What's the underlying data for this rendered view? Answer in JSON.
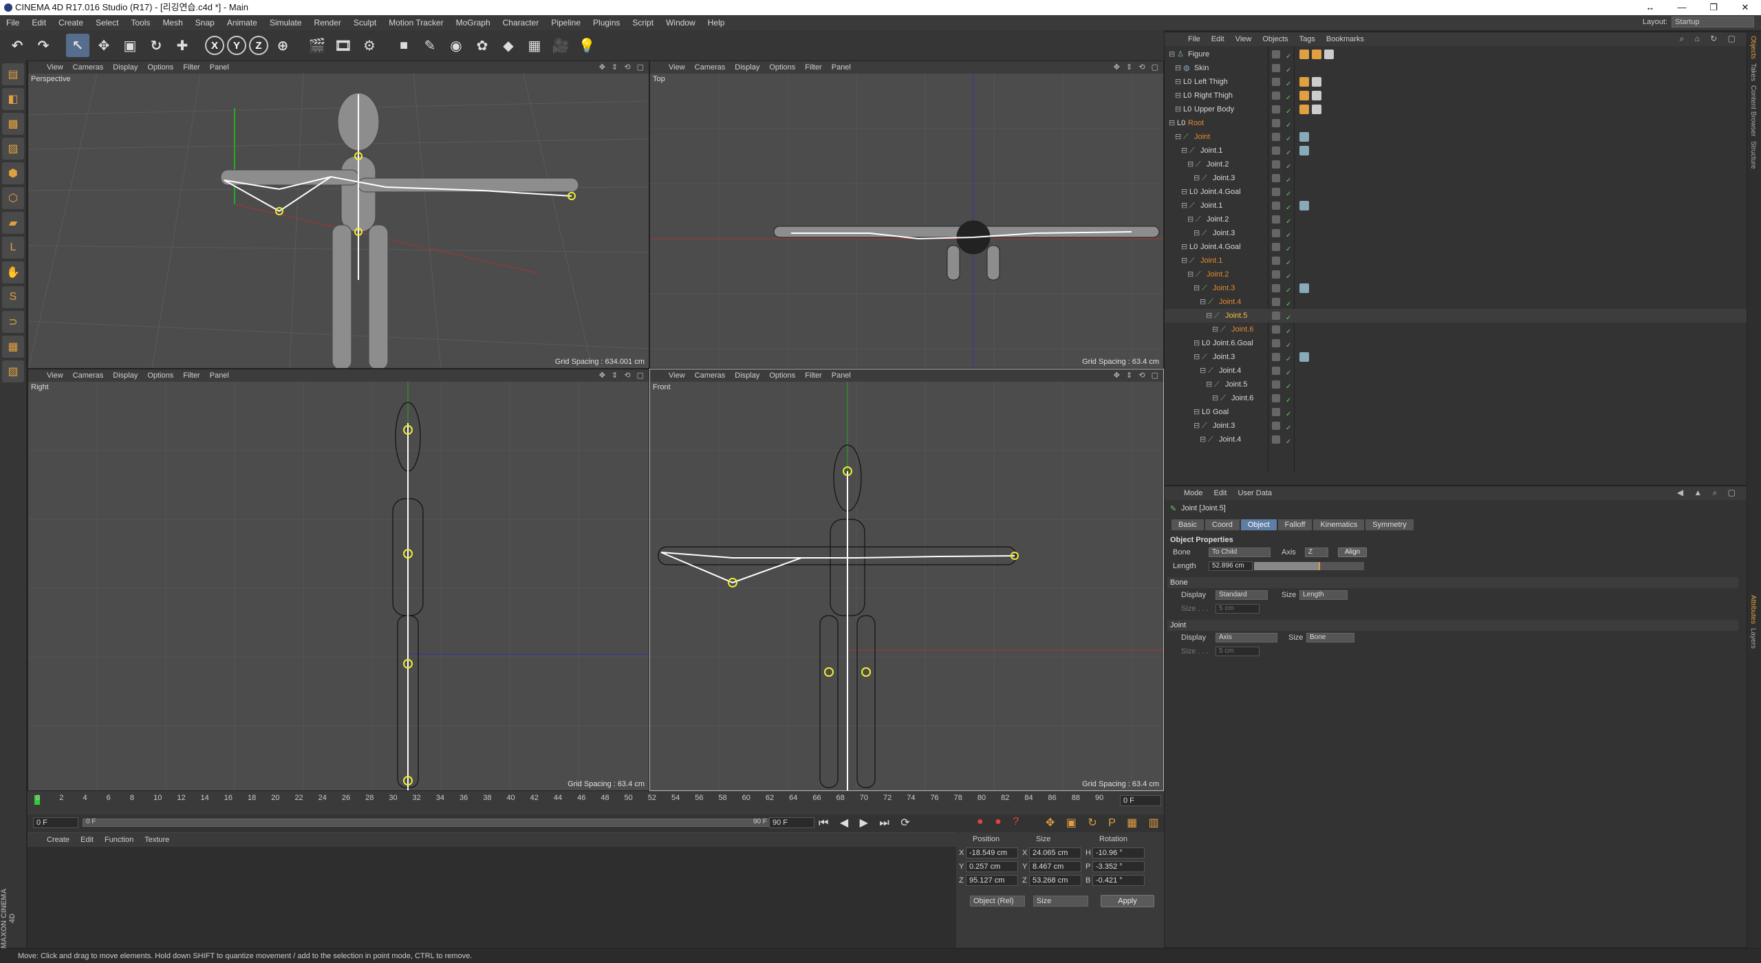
{
  "window": {
    "title": "CINEMA 4D R17.016 Studio (R17) - [리깅연습.c4d *] - Main",
    "controls": [
      "↔",
      "—",
      "❐",
      "✕"
    ]
  },
  "menubar": [
    "File",
    "Edit",
    "Create",
    "Select",
    "Tools",
    "Mesh",
    "Snap",
    "Animate",
    "Simulate",
    "Render",
    "Sculpt",
    "Motion Tracker",
    "MoGraph",
    "Character",
    "Pipeline",
    "Plugins",
    "Script",
    "Window",
    "Help"
  ],
  "layout": {
    "label": "Layout:",
    "value": "Startup"
  },
  "toolbar": {
    "icons": [
      {
        "name": "undo-icon",
        "glyph": "↶"
      },
      {
        "name": "redo-icon",
        "glyph": "↷"
      },
      {
        "name": "select-icon",
        "glyph": "↖"
      },
      {
        "name": "move-icon",
        "glyph": "✥"
      },
      {
        "name": "scale-icon",
        "glyph": "▣"
      },
      {
        "name": "rotate-icon",
        "glyph": "↻"
      },
      {
        "name": "add-icon",
        "glyph": "✚"
      },
      {
        "name": "x-axis-icon",
        "glyph": "X"
      },
      {
        "name": "y-axis-icon",
        "glyph": "Y"
      },
      {
        "name": "z-axis-icon",
        "glyph": "Z"
      },
      {
        "name": "coordinate-system-icon",
        "glyph": "⊕"
      },
      {
        "name": "render-view-icon",
        "glyph": "🎬"
      },
      {
        "name": "render-picture-viewer-icon",
        "glyph": "🎞"
      },
      {
        "name": "edit-render-settings-icon",
        "glyph": "⚙"
      },
      {
        "name": "cube-icon",
        "glyph": "■"
      },
      {
        "name": "pen-icon",
        "glyph": "✎"
      },
      {
        "name": "subdivision-icon",
        "glyph": "◉"
      },
      {
        "name": "array-icon",
        "glyph": "✿"
      },
      {
        "name": "deformer-icon",
        "glyph": "◆"
      },
      {
        "name": "floor-icon",
        "glyph": "▦"
      },
      {
        "name": "camera-icon",
        "glyph": "🎥"
      },
      {
        "name": "light-icon",
        "glyph": "💡"
      }
    ]
  },
  "lefttools": [
    {
      "name": "make-editable-icon",
      "glyph": "▤"
    },
    {
      "name": "model-mode-icon",
      "glyph": "◧"
    },
    {
      "name": "texture-mode-icon",
      "glyph": "▩"
    },
    {
      "name": "workplane-icon",
      "glyph": "▨"
    },
    {
      "name": "points-mode-icon",
      "glyph": "⬢"
    },
    {
      "name": "edges-mode-icon",
      "glyph": "⬡"
    },
    {
      "name": "polygons-mode-icon",
      "glyph": "▰"
    },
    {
      "name": "axis-mode-icon",
      "glyph": "L"
    },
    {
      "name": "tweak-mode-icon",
      "glyph": "✋"
    },
    {
      "name": "snap-icon",
      "glyph": "S"
    },
    {
      "name": "magnet-icon",
      "glyph": "⊃"
    },
    {
      "name": "locked-workplane-icon",
      "glyph": "▦"
    },
    {
      "name": "planar-workplane-icon",
      "glyph": "▧"
    }
  ],
  "maxon": "MAXON CINEMA 4D",
  "viewports": [
    {
      "id": "perspective",
      "label": "Perspective",
      "menu": [
        "View",
        "Cameras",
        "Display",
        "Options",
        "Filter",
        "Panel"
      ],
      "grid": "Grid Spacing : 634.001 cm"
    },
    {
      "id": "top",
      "label": "Top",
      "menu": [
        "View",
        "Cameras",
        "Display",
        "Options",
        "Filter",
        "Panel"
      ],
      "grid": "Grid Spacing : 63.4 cm"
    },
    {
      "id": "right",
      "label": "Right",
      "menu": [
        "View",
        "Cameras",
        "Display",
        "Options",
        "Filter",
        "Panel"
      ],
      "grid": "Grid Spacing : 63.4 cm"
    },
    {
      "id": "front",
      "label": "Front",
      "menu": [
        "View",
        "Cameras",
        "Display",
        "Options",
        "Filter",
        "Panel"
      ],
      "grid": "Grid Spacing : 63.4 cm"
    }
  ],
  "timeline": {
    "ticks": [
      "0",
      "2",
      "4",
      "6",
      "8",
      "10",
      "12",
      "14",
      "16",
      "18",
      "20",
      "22",
      "24",
      "26",
      "28",
      "30",
      "32",
      "34",
      "36",
      "38",
      "40",
      "42",
      "44",
      "46",
      "48",
      "50",
      "52",
      "54",
      "56",
      "58",
      "60",
      "62",
      "64",
      "66",
      "68",
      "70",
      "72",
      "74",
      "76",
      "78",
      "80",
      "82",
      "84",
      "86",
      "88",
      "90"
    ],
    "current_frame": "0 F",
    "start": "0 F",
    "end": "90 F",
    "range_min": "0 F",
    "range_max": "90 F"
  },
  "material_manager": {
    "menu": [
      "Create",
      "Edit",
      "Function",
      "Texture"
    ]
  },
  "coordinates": {
    "headers": [
      "Position",
      "Size",
      "Rotation"
    ],
    "rows": [
      {
        "axis": "X",
        "pos": "-18.549 cm",
        "size_axis": "X",
        "size": "24.065 cm",
        "rot_axis": "H",
        "rot": "-10.96 °"
      },
      {
        "axis": "Y",
        "pos": "0.257 cm",
        "size_axis": "Y",
        "size": "8.467 cm",
        "rot_axis": "P",
        "rot": "-3.352 °"
      },
      {
        "axis": "Z",
        "pos": "95.127 cm",
        "size_axis": "Z",
        "size": "53.268 cm",
        "rot_axis": "B",
        "rot": "-0.421 °"
      }
    ],
    "mode": "Object (Rel)",
    "size_mode": "Size",
    "apply": "Apply"
  },
  "object_manager": {
    "menu": [
      "File",
      "Edit",
      "View",
      "Objects",
      "Tags",
      "Bookmarks"
    ],
    "rows": [
      {
        "name": "Figure",
        "indent": 0,
        "color": "#d8d8d8",
        "icon": "figure",
        "tags": [
          "#e0a040",
          "#e0a040",
          "#ccc"
        ]
      },
      {
        "name": "Skin",
        "indent": 1,
        "color": "#d8d8d8",
        "icon": "skin",
        "tags": []
      },
      {
        "name": "Left Thigh",
        "indent": 1,
        "color": "#d8d8d8",
        "icon": "null",
        "tags": [
          "#e0a040",
          "#ccc"
        ]
      },
      {
        "name": "Right Thigh",
        "indent": 1,
        "color": "#d8d8d8",
        "icon": "null",
        "tags": [
          "#e0a040",
          "#ccc"
        ]
      },
      {
        "name": "Upper Body",
        "indent": 1,
        "color": "#d8d8d8",
        "icon": "null",
        "tags": [
          "#e0a040",
          "#ccc"
        ]
      },
      {
        "name": "Root",
        "indent": 0,
        "color": "#e08a30",
        "icon": "null",
        "tags": []
      },
      {
        "name": "Joint",
        "indent": 1,
        "color": "#e08a30",
        "icon": "joint",
        "tags": [
          "#8ab"
        ]
      },
      {
        "name": "Joint.1",
        "indent": 2,
        "color": "#d8d8d8",
        "icon": "joint",
        "tags": [
          "#8ab"
        ]
      },
      {
        "name": "Joint.2",
        "indent": 3,
        "color": "#d8d8d8",
        "icon": "joint",
        "tags": []
      },
      {
        "name": "Joint.3",
        "indent": 4,
        "color": "#d8d8d8",
        "icon": "joint",
        "tags": []
      },
      {
        "name": "Joint.4.Goal",
        "indent": 2,
        "color": "#d8d8d8",
        "icon": "null",
        "tags": []
      },
      {
        "name": "Joint.1",
        "indent": 2,
        "color": "#d8d8d8",
        "icon": "joint",
        "tags": [
          "#8ab"
        ]
      },
      {
        "name": "Joint.2",
        "indent": 3,
        "color": "#d8d8d8",
        "icon": "joint",
        "tags": []
      },
      {
        "name": "Joint.3",
        "indent": 4,
        "color": "#d8d8d8",
        "icon": "joint",
        "tags": []
      },
      {
        "name": "Joint.4.Goal",
        "indent": 2,
        "color": "#d8d8d8",
        "icon": "null",
        "tags": []
      },
      {
        "name": "Joint.1",
        "indent": 2,
        "color": "#e08a30",
        "icon": "joint",
        "tags": []
      },
      {
        "name": "Joint.2",
        "indent": 3,
        "color": "#e08a30",
        "icon": "joint",
        "tags": []
      },
      {
        "name": "Joint.3",
        "indent": 4,
        "color": "#e08a30",
        "icon": "joint",
        "tags": [
          "#8ab"
        ]
      },
      {
        "name": "Joint.4",
        "indent": 5,
        "color": "#e08a30",
        "icon": "joint",
        "tags": []
      },
      {
        "name": "Joint.5",
        "indent": 6,
        "color": "#f5c040",
        "icon": "joint",
        "tags": []
      },
      {
        "name": "Joint.6",
        "indent": 7,
        "color": "#e08a30",
        "icon": "joint",
        "tags": []
      },
      {
        "name": "Joint.6.Goal",
        "indent": 4,
        "color": "#d8d8d8",
        "icon": "null",
        "tags": []
      },
      {
        "name": "Joint.3",
        "indent": 4,
        "color": "#d8d8d8",
        "icon": "joint",
        "tags": [
          "#8ab"
        ]
      },
      {
        "name": "Joint.4",
        "indent": 5,
        "color": "#d8d8d8",
        "icon": "joint",
        "tags": []
      },
      {
        "name": "Joint.5",
        "indent": 6,
        "color": "#d8d8d8",
        "icon": "joint",
        "tags": []
      },
      {
        "name": "Joint.6",
        "indent": 7,
        "color": "#d8d8d8",
        "icon": "joint",
        "tags": []
      },
      {
        "name": "Goal",
        "indent": 4,
        "color": "#d8d8d8",
        "icon": "null",
        "tags": []
      },
      {
        "name": "Joint.3",
        "indent": 4,
        "color": "#d8d8d8",
        "icon": "joint",
        "tags": []
      },
      {
        "name": "Joint.4",
        "indent": 5,
        "color": "#d8d8d8",
        "icon": "joint",
        "tags": []
      }
    ]
  },
  "attribute_manager": {
    "menu": [
      "Mode",
      "Edit",
      "User Data"
    ],
    "title": "Joint [Joint.5]",
    "tabs": [
      "Basic",
      "Coord",
      "Object",
      "Falloff",
      "Kinematics",
      "Symmetry"
    ],
    "active_tab": "Object",
    "section": "Object Properties",
    "bone_label": "Bone",
    "bone_value": "To Child",
    "axis_label": "Axis",
    "axis_value": "Z",
    "align": "Align",
    "length_label": "Length",
    "length_value": "52.896 cm",
    "length_fraction": 0.6,
    "bone_group": "Bone",
    "bone_display_label": "Display",
    "bone_display_value": "Standard",
    "bone_size_label": "Size",
    "bone_size_value": "Length",
    "bone_size2_label": "Size . . .",
    "bone_size2_value": "5 cm",
    "joint_group": "Joint",
    "joint_display_label": "Display",
    "joint_display_value": "Axis",
    "joint_size_label": "Size",
    "joint_size_value": "Bone",
    "joint_size2_label": "Size . . .",
    "joint_size2_value": "5 cm"
  },
  "right_strip": [
    {
      "label": "Objects",
      "active": true
    },
    {
      "label": "Takes",
      "active": false
    },
    {
      "label": "Content Browser",
      "active": false
    },
    {
      "label": "Structure",
      "active": false
    },
    {
      "label": "Attributes",
      "active": true
    },
    {
      "label": "Layers",
      "active": false
    }
  ],
  "status": "Move: Click and drag to move elements. Hold down SHIFT to quantize movement / add to the selection in point mode, CTRL to remove."
}
